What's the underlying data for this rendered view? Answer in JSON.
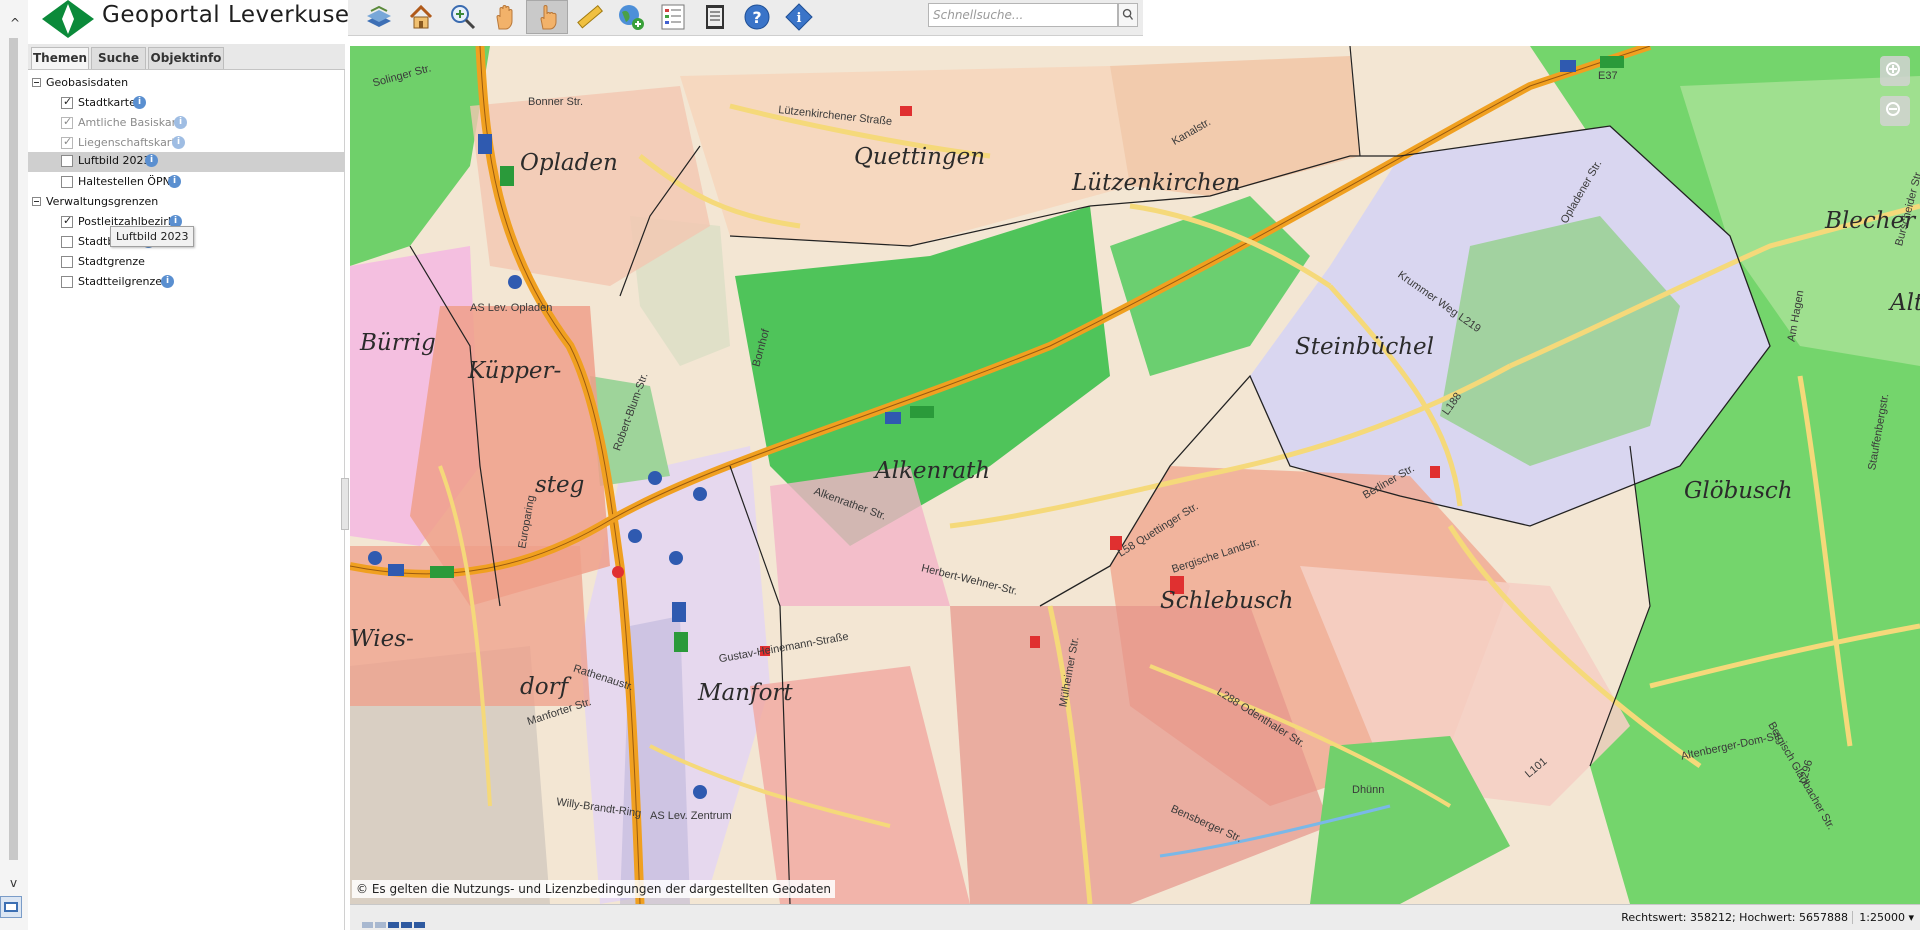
{
  "header": {
    "title": "Geoportal Leverkusen",
    "logo_colors": [
      "#0b8a3a",
      "#ffffff"
    ]
  },
  "toolbar": {
    "tools": [
      {
        "name": "layers-tool",
        "icon": "layers-icon"
      },
      {
        "name": "home-tool",
        "icon": "home-icon"
      },
      {
        "name": "zoom-tool",
        "icon": "zoom-magnifier-icon"
      },
      {
        "name": "pan-tool",
        "icon": "hand-icon"
      },
      {
        "name": "select-tool",
        "icon": "pointer-hand-icon",
        "active": true
      },
      {
        "name": "measure-tool",
        "icon": "ruler-icon"
      },
      {
        "name": "add-service-tool",
        "icon": "globe-plus-icon"
      },
      {
        "name": "legend-tool",
        "icon": "legend-list-icon"
      },
      {
        "name": "print-tool",
        "icon": "printer-icon"
      },
      {
        "name": "help-tool",
        "icon": "help-icon"
      },
      {
        "name": "info-tool",
        "icon": "info-diamond-icon"
      }
    ],
    "search_placeholder": "Schnellsuche..."
  },
  "panel": {
    "tabs": [
      {
        "label": "Themen",
        "active": true
      },
      {
        "label": "Suche"
      },
      {
        "label": "Objektinfo"
      }
    ],
    "groups": [
      {
        "label": "Geobasisdaten",
        "items": [
          {
            "label": "Stadtkarte",
            "checked": true
          },
          {
            "label": "Amtliche Basiskarte",
            "checked": true,
            "disabled": true
          },
          {
            "label": "Liegenschaftskarte",
            "checked": true,
            "disabled": true
          },
          {
            "label": "Luftbild 2023",
            "checked": false,
            "selected": true
          },
          {
            "label": "Haltestellen ÖPNV",
            "checked": false
          }
        ]
      },
      {
        "label": "Verwaltungsgrenzen",
        "items": [
          {
            "label": "Postleitzahlbezirke",
            "checked": true
          },
          {
            "label": "Stadtbezirke",
            "checked": false
          },
          {
            "label": "Stadtgrenze",
            "checked": false
          },
          {
            "label": "Stadtteilgrenzen",
            "checked": false
          }
        ]
      }
    ],
    "tooltip": "Luftbild 2023"
  },
  "map": {
    "places": [
      "Opladen",
      "Quettingen",
      "Lützenkirchen",
      "Blecher",
      "Bürrig",
      "Küpper-",
      "steg",
      "Steinbüchel",
      "Alkenrath",
      "Alt",
      "Glöbusch",
      "Wies-",
      "dorf",
      "Schlebusch",
      "Manfort"
    ],
    "streets": [
      "Bonner Str.",
      "Lützenkirchener Straße",
      "Kanalstr.",
      "Europaring",
      "Robert-Blum-Str.",
      "Bornhof",
      "Krummer Weg L219",
      "L188",
      "Berliner Str.",
      "Alkenrather Str.",
      "Herbert-Wehner-Str.",
      "L58 Quettinger Str.",
      "Bergische Landstr.",
      "Gustav-Heinemann-Straße",
      "Rathenaustr.",
      "Manforter Str.",
      "Willy-Brandt-Ring",
      "AS Lev. Zentrum",
      "AS Lev. Opladen",
      "L288 Odenthaler Str.",
      "Bensberger Str.",
      "Dhünn",
      "L101",
      "Altenberger-Dom-Str.",
      "Bergisch Gladbacher Str.",
      "Burscheider Str.",
      "Am Hagen",
      "Mülheimer Str.",
      "L296",
      "E37",
      "Stauffenbergstr.",
      "Opladener Str.",
      "Solinger Str."
    ],
    "copyright": "© Es gelten die Nutzungs- und Lizenzbedingungen der dargestellten Geodaten"
  },
  "statusbar": {
    "coords": "Rechtswert: 358212; Hochwert: 5657888",
    "scale": "1:25000 ▾"
  }
}
